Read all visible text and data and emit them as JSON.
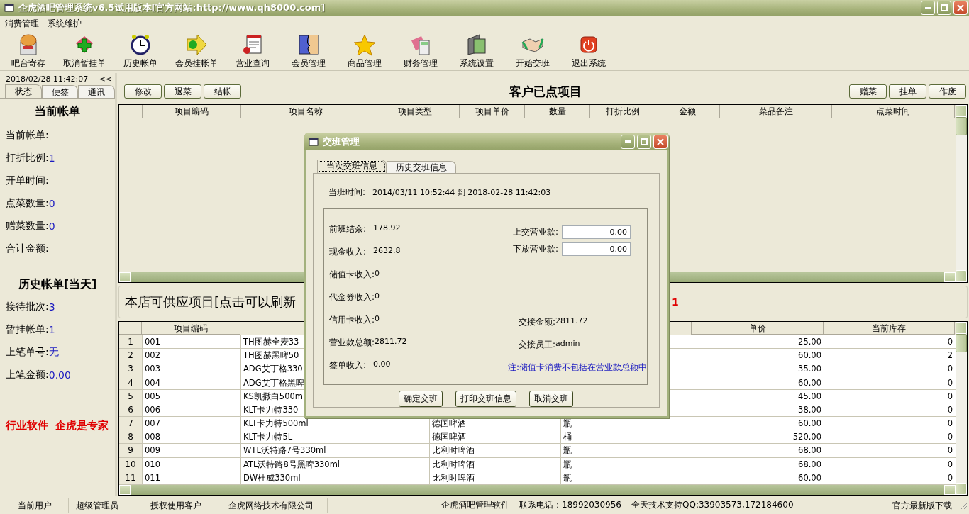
{
  "window": {
    "title": "企虎酒吧管理系统v6.5试用版本[官方网站:http://www.qh8000.com]"
  },
  "menu": [
    "消费管理",
    "系统维护"
  ],
  "toolbar": [
    "吧台寄存",
    "取消暂挂单",
    "历史帐单",
    "会员挂帐单",
    "营业查询",
    "会员管理",
    "商品管理",
    "财务管理",
    "系统设置",
    "开始交班",
    "退出系统"
  ],
  "left_panel": {
    "datetime": "2018/02/28 11:42:07",
    "collapse": "<<",
    "tabs": [
      {
        "label": "状态",
        "selected": true
      },
      {
        "label": "便签",
        "selected": false
      },
      {
        "label": "通讯",
        "selected": false
      }
    ],
    "current_bill": {
      "title": "当前帐单",
      "fields": [
        {
          "label": "当前帐单:"
        },
        {
          "label": "打折比例:",
          "value": "1"
        },
        {
          "label": "开单时间:"
        },
        {
          "label": "点菜数量:",
          "value": "0"
        },
        {
          "label": "赠菜数量:",
          "value": "0"
        },
        {
          "label": "合计金额:"
        }
      ]
    },
    "history": {
      "title": "历史帐单[当天]",
      "fields": [
        {
          "label": "接待批次:",
          "value": "3"
        },
        {
          "label": "暂挂帐单:",
          "value": "1"
        },
        {
          "label": "上笔单号:",
          "value": "无"
        },
        {
          "label": "上笔金额:",
          "value": "0.00"
        }
      ]
    },
    "slogan": "行业软件  企虎是专家"
  },
  "order_panel": {
    "buttons_left": [
      "修改",
      "退菜",
      "结帐"
    ],
    "title": "客户已点项目",
    "buttons_right": [
      "赠菜",
      "挂单",
      "作废"
    ],
    "table": {
      "columns": [
        "项目编码",
        "项目名称",
        "项目类型",
        "项目单价",
        "数量",
        "打折比例",
        "金额",
        "菜品备注",
        "点菜时间"
      ]
    }
  },
  "items_panel": {
    "title": "本店可供应项目[点击可以刷新",
    "title_tail": "1",
    "table": {
      "columns": [
        "项目编码",
        null,
        null,
        null,
        "单价",
        "当前库存"
      ],
      "rows": [
        {
          "no": "1",
          "code": "001",
          "name": "TH图赫全麦33",
          "type": null,
          "unit": null,
          "price": "25.00",
          "stock": "0"
        },
        {
          "no": "2",
          "code": "002",
          "name": "TH图赫黑啤50",
          "type": null,
          "unit": null,
          "price": "60.00",
          "stock": "2"
        },
        {
          "no": "3",
          "code": "003",
          "name": "ADG艾丁格330",
          "type": null,
          "unit": null,
          "price": "35.00",
          "stock": "0"
        },
        {
          "no": "4",
          "code": "004",
          "name": "ADG艾丁格黑啤",
          "type": null,
          "unit": null,
          "price": "60.00",
          "stock": "0"
        },
        {
          "no": "5",
          "code": "005",
          "name": "KS凯撒白500m",
          "type": null,
          "unit": null,
          "price": "45.00",
          "stock": "0"
        },
        {
          "no": "6",
          "code": "006",
          "name": "KLT卡力特330",
          "type": null,
          "unit": null,
          "price": "38.00",
          "stock": "0"
        },
        {
          "no": "7",
          "code": "007",
          "name": "KLT卡力特500ml",
          "type": "德国啤酒",
          "unit": "瓶",
          "price": "60.00",
          "stock": "0"
        },
        {
          "no": "8",
          "code": "008",
          "name": "KLT卡力特5L",
          "type": "德国啤酒",
          "unit": "桶",
          "price": "520.00",
          "stock": "0"
        },
        {
          "no": "9",
          "code": "009",
          "name": "WTL沃特路7号330ml",
          "type": "比利时啤酒",
          "unit": "瓶",
          "price": "68.00",
          "stock": "0"
        },
        {
          "no": "10",
          "code": "010",
          "name": "ATL沃特路8号黑啤330ml",
          "type": "比利时啤酒",
          "unit": "瓶",
          "price": "68.00",
          "stock": "0"
        },
        {
          "no": "11",
          "code": "011",
          "name": "DW杜威330ml",
          "type": "比利时啤酒",
          "unit": "瓶",
          "price": "60.00",
          "stock": "0"
        }
      ]
    }
  },
  "dialog": {
    "title": "交班管理",
    "tabs": [
      {
        "label": "当次交班信息",
        "selected": true
      },
      {
        "label": "历史交班信息",
        "selected": false
      }
    ],
    "shift_time_label": "当班时间:",
    "shift_time": "2014/03/11 10:52:44 到 2018-02-28 11:42:03",
    "left_fields": [
      {
        "label": "前班结余:",
        "value": "178.92"
      },
      {
        "label": "现金收入:",
        "value": "2632.8"
      },
      {
        "label": "储值卡收入:",
        "value": "0"
      },
      {
        "label": "代金券收入:",
        "value": "0"
      },
      {
        "label": "信用卡收入:",
        "value": "0"
      },
      {
        "label": "营业款总额:",
        "value": "2811.72"
      },
      {
        "label": "签单收入:",
        "value": "0.00"
      }
    ],
    "inputs": [
      {
        "label": "上交营业款:",
        "value": "0.00"
      },
      {
        "label": "下放营业款:",
        "value": "0.00"
      }
    ],
    "right_fields": [
      {
        "label": "交接金额:",
        "value": "2811.72"
      },
      {
        "label": "交接员工:",
        "value": "admin"
      }
    ],
    "note": "注:储值卡消费不包括在营业款总额中",
    "buttons": [
      "确定交班",
      "打印交班信息",
      "取消交班"
    ]
  },
  "status_bar": {
    "cells": [
      "当前用户",
      "超级管理员",
      "授权使用客户",
      "企虎网络技术有限公司"
    ],
    "center": [
      "企虎酒吧管理软件",
      "联系电话：18992030956",
      "全天技术支持QQ:33903573,172184600"
    ],
    "right": "官方最新版下载"
  }
}
